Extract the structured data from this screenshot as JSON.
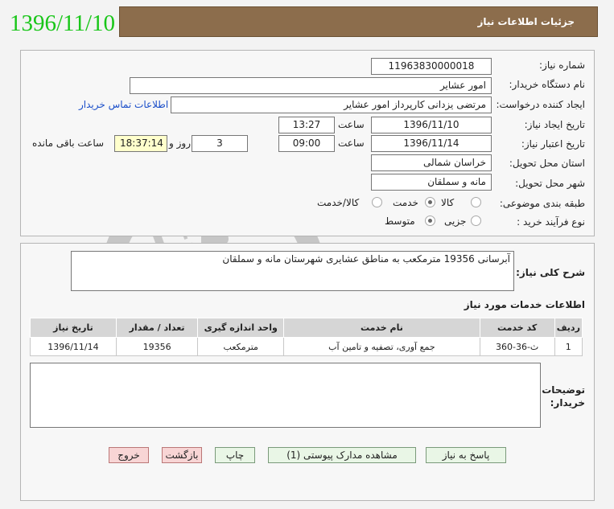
{
  "date_stamp": "1396/11/10",
  "header": {
    "title": "جزئیات اطلاعات نیاز"
  },
  "colors": {
    "header_bg": "#8c6d4c",
    "date_stamp": "#19c619",
    "button_green": "#e9f6e6",
    "button_red": "#f8d5d5"
  },
  "form": {
    "need_number_label": "شماره نیاز:",
    "need_number": "11963830000018",
    "buyer_org_label": "نام دستگاه خریدار:",
    "buyer_org": "امور عشایر",
    "requester_label": "ایجاد کننده درخواست:",
    "requester": "مرتضی  یزدانی کارپرداز     امور عشایر",
    "contact_link": "اطلاعات تماس خریدار",
    "created_label": "تاریخ ایجاد نیاز:",
    "created_date": "1396/11/10",
    "time_label": "ساعت",
    "created_time": "13:27",
    "valid_label": "تاریخ اعتبار نیاز:",
    "valid_date": "1396/11/14",
    "valid_time": "09:00",
    "days_remaining": "3",
    "day_and_label": "روز و",
    "time_remaining": "18:37:14",
    "remaining_label": "ساعت باقی مانده",
    "province_label": "استان محل تحویل:",
    "province": "خراسان شمالی",
    "city_label": "شهر محل تحویل:",
    "city": "مانه و سملقان",
    "category_label": "طبقه بندی موضوعی:",
    "category_options": [
      "کالا",
      "خدمت",
      "کالا/خدمت"
    ],
    "category_selected": "خدمت",
    "process_label": "نوع فرآیند خرید :",
    "process_options": [
      "جزیی",
      "متوسط"
    ],
    "process_selected": "متوسط"
  },
  "description": {
    "label": "شرح کلی نیاز:",
    "text": "آبرسانی 19356 مترمکعب به مناطق عشایری شهرستان مانه و سملقان"
  },
  "services": {
    "title": "اطلاعات خدمات مورد نیاز",
    "columns": [
      "ردیف",
      "کد خدمت",
      "نام خدمت",
      "واحد اندازه گیری",
      "تعداد / مقدار",
      "تاریخ نیاز"
    ],
    "rows": [
      [
        "1",
        "ث-36-360",
        "جمع آوری، تصفیه و تامین آب",
        "مترمکعب",
        "19356",
        "1396/11/14"
      ]
    ]
  },
  "notes": {
    "label_line1": "توضیحات",
    "label_line2": "خریدار:",
    "text": ""
  },
  "buttons": {
    "reply": "پاسخ به نیاز",
    "attachments": "مشاهده مدارک پیوستی (1)",
    "print": "چاپ",
    "back": "بازگشت",
    "exit": "خروج"
  },
  "watermark": {
    "icon": "hezareh-gostaran-logo-icon"
  }
}
